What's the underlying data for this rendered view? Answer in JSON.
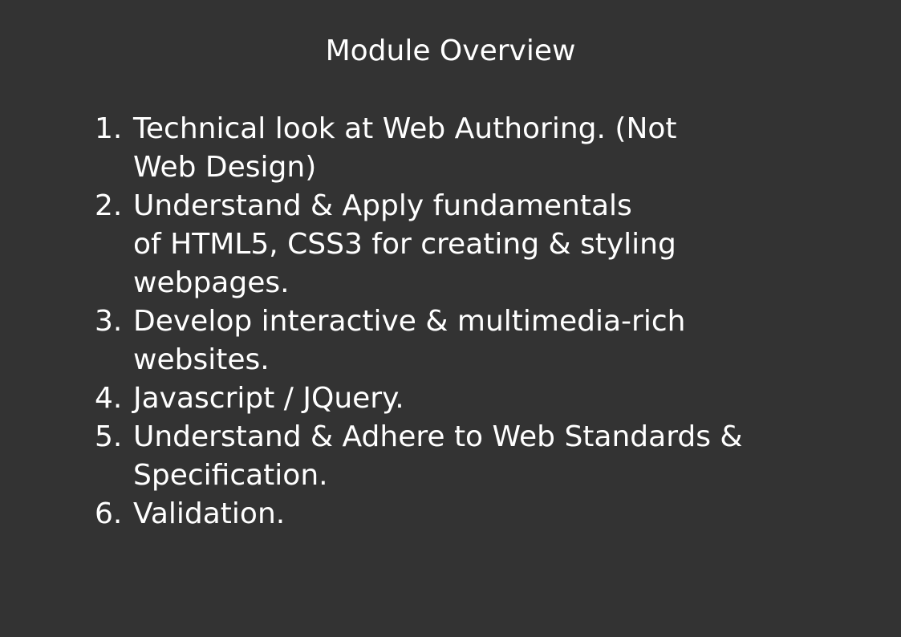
{
  "slide": {
    "title": "Module Overview",
    "items": [
      {
        "number": "1.",
        "lines": [
          "Technical look at Web Authoring. (Not",
          "Web Design)"
        ]
      },
      {
        "number": "2.",
        "lines": [
          "Understand & Apply fundamentals",
          "of HTML5, CSS3 for creating & styling",
          "webpages."
        ]
      },
      {
        "number": "3.",
        "lines": [
          "Develop interactive & multimedia-rich",
          "websites."
        ]
      },
      {
        "number": "4.",
        "lines": [
          "Javascript / JQuery."
        ]
      },
      {
        "number": "5.",
        "lines": [
          "Understand & Adhere to Web Standards &",
          "Specification."
        ]
      },
      {
        "number": "6.",
        "lines": [
          "Validation."
        ]
      }
    ]
  },
  "colors": {
    "background": "#333333",
    "text": "#ffffff"
  }
}
